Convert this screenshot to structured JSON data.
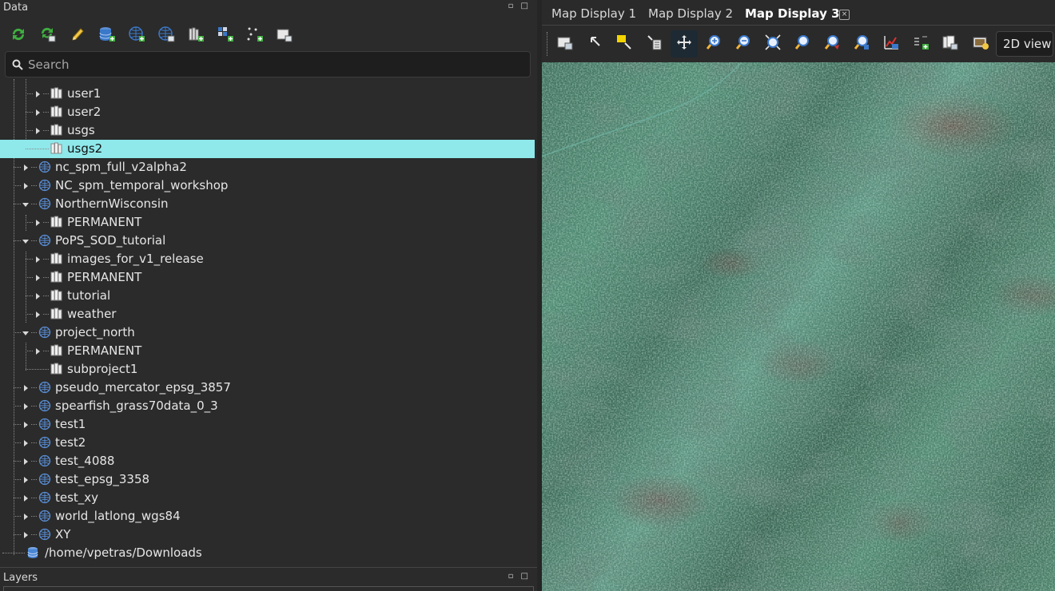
{
  "data_panel": {
    "title": "Data",
    "dock_buttons": "▫ □"
  },
  "data_toolbar": [
    {
      "name": "reload-icon"
    },
    {
      "name": "reload-current-icon"
    },
    {
      "name": "rename-pencil-icon"
    },
    {
      "name": "add-database-icon"
    },
    {
      "name": "add-location-icon"
    },
    {
      "name": "import-location-icon"
    },
    {
      "name": "add-mapset-icon"
    },
    {
      "name": "add-grid-layer-icon"
    },
    {
      "name": "add-vector-icon"
    },
    {
      "name": "display-layer-icon"
    }
  ],
  "search": {
    "placeholder": "Search",
    "value": ""
  },
  "tree": [
    {
      "label": "user1"
    },
    {
      "label": "user2"
    },
    {
      "label": "usgs"
    },
    {
      "label": "usgs2"
    },
    {
      "label": "nc_spm_full_v2alpha2"
    },
    {
      "label": "NC_spm_temporal_workshop"
    },
    {
      "label": "NorthernWisconsin"
    },
    {
      "label": "PERMANENT"
    },
    {
      "label": "PoPS_SOD_tutorial"
    },
    {
      "label": "images_for_v1_release"
    },
    {
      "label": "PERMANENT"
    },
    {
      "label": "tutorial"
    },
    {
      "label": "weather"
    },
    {
      "label": "project_north"
    },
    {
      "label": "PERMANENT"
    },
    {
      "label": "subproject1"
    },
    {
      "label": "pseudo_mercator_epsg_3857"
    },
    {
      "label": "spearfish_grass70data_0_3"
    },
    {
      "label": "test1"
    },
    {
      "label": "test2"
    },
    {
      "label": "test_4088"
    },
    {
      "label": "test_epsg_3358"
    },
    {
      "label": "test_xy"
    },
    {
      "label": "world_latlong_wgs84"
    },
    {
      "label": "XY"
    },
    {
      "label": "/home/vpetras/Downloads"
    }
  ],
  "layers_panel": {
    "title": "Layers",
    "dock_buttons": "▫ □"
  },
  "tabs": [
    {
      "label": "Map Display 1"
    },
    {
      "label": "Map Display 2"
    },
    {
      "label": "Map Display 3",
      "active": true
    }
  ],
  "map_toolbar": [
    {
      "name": "display-map-icon"
    },
    {
      "name": "pointer-icon"
    },
    {
      "name": "select-icon"
    },
    {
      "name": "query-icon"
    },
    {
      "name": "pan-icon"
    },
    {
      "name": "zoom-in-icon"
    },
    {
      "name": "zoom-out-icon"
    },
    {
      "name": "zoom-extent-icon"
    },
    {
      "name": "zoom-back-icon"
    },
    {
      "name": "zoom-menu-icon"
    },
    {
      "name": "zoom-region-icon"
    },
    {
      "name": "analyze-icon"
    },
    {
      "name": "overlay-icon"
    },
    {
      "name": "save-image-icon"
    },
    {
      "name": "print-icon"
    }
  ],
  "view_mode": {
    "value": "2D view"
  },
  "colors": {
    "selection": "#8fe8ea",
    "panel": "#2b2b2b",
    "icon_green": "#3fae3f",
    "icon_blue": "#3a78c9"
  }
}
